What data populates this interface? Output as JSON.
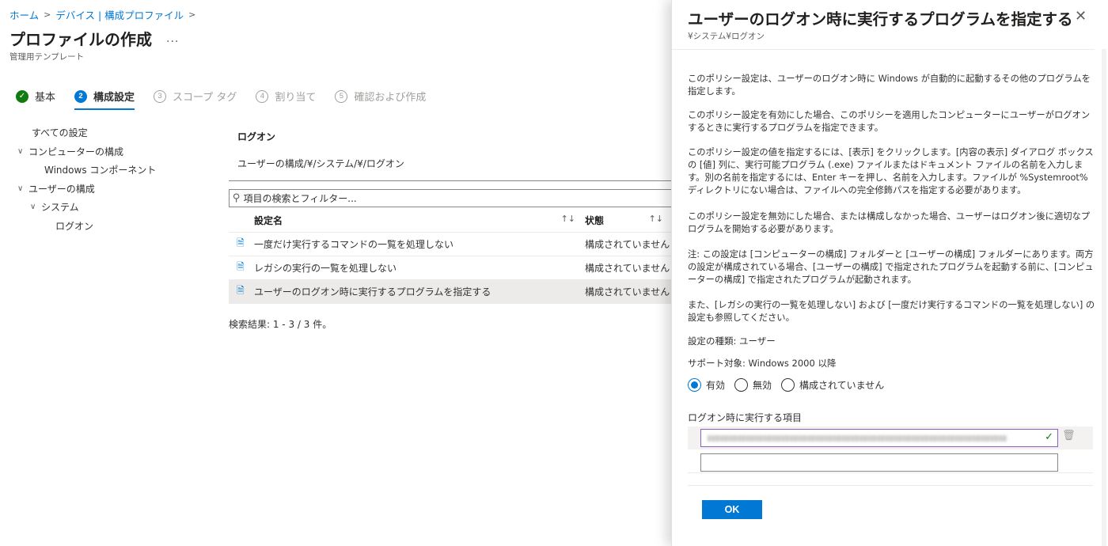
{
  "breadcrumb": {
    "items": [
      "ホーム",
      "デバイス | 構成プロファイル"
    ],
    "sep": ">"
  },
  "page": {
    "title": "プロファイルの作成",
    "more": "...",
    "subtitle": "管理用テンプレート"
  },
  "steps": [
    {
      "num": "✓",
      "label": "基本",
      "status": "done"
    },
    {
      "num": "2",
      "label": "構成設定",
      "status": "active"
    },
    {
      "num": "3",
      "label": "スコープ タグ",
      "status": "disabled"
    },
    {
      "num": "4",
      "label": "割り当て",
      "status": "disabled"
    },
    {
      "num": "5",
      "label": "確認および作成",
      "status": "disabled"
    }
  ],
  "tree": [
    {
      "label": "すべての設定",
      "chev": ""
    },
    {
      "label": "コンピューターの構成",
      "chev": "∨"
    },
    {
      "label": "Windows コンポーネント",
      "chev": ""
    },
    {
      "label": "ユーザーの構成",
      "chev": "∨"
    },
    {
      "label": "システム",
      "chev": "∨"
    },
    {
      "label": "ログオン",
      "chev": ""
    }
  ],
  "content": {
    "section_title": "ログオン",
    "path": "ユーザーの構成/¥/システム/¥/ログオン",
    "search_placeholder": "項目の検索とフィルター...",
    "columns": {
      "name": "設定名",
      "state": "状態",
      "sort": "↑↓"
    },
    "rows": [
      {
        "name": "一度だけ実行するコマンドの一覧を処理しない",
        "state": "構成されていません"
      },
      {
        "name": "レガシの実行の一覧を処理しない",
        "state": "構成されていません"
      },
      {
        "name": "ユーザーのログオン時に実行するプログラムを指定する",
        "state": "構成されていません"
      }
    ],
    "results": "検索結果: 1 - 3 / 3 件。"
  },
  "blade": {
    "title": "ユーザーのログオン時に実行するプログラムを指定する",
    "close": "✕",
    "subtitle": "¥システム¥ログオン",
    "paragraphs": [
      "このポリシー設定は、ユーザーのログオン時に Windows が自動的に起動するその他のプログラムを指定します。",
      "このポリシー設定を有効にした場合、このポリシーを適用したコンピューターにユーザーがログオンするときに実行するプログラムを指定できます。",
      "このポリシー設定の値を指定するには、[表示] をクリックします。[内容の表示] ダイアログ ボックスの [値] 列に、実行可能プログラム (.exe) ファイルまたはドキュメント ファイルの名前を入力します。別の名前を指定するには、Enter キーを押し、名前を入力します。ファイルが %Systemroot% ディレクトリにない場合は、ファイルへの完全修飾パスを指定する必要があります。",
      "このポリシー設定を無効にした場合、または構成しなかった場合、ユーザーはログオン後に適切なプログラムを開始する必要があります。",
      "注: この設定は [コンピューターの構成] フォルダーと [ユーザーの構成] フォルダーにあります。両方の設定が構成されている場合、[ユーザーの構成] で指定されたプログラムを起動する前に、[コンピューターの構成] で指定されたプログラムが起動されます。",
      "また、[レガシの実行の一覧を処理しない] および [一度だけ実行するコマンドの一覧を処理しない] の設定も参照してください。"
    ],
    "setting_type": "設定の種類: ユーザー",
    "supported": "サポート対象: Windows 2000 以降",
    "radios": [
      {
        "label": "有効",
        "checked": true
      },
      {
        "label": "無効",
        "checked": false
      },
      {
        "label": "構成されていません",
        "checked": false
      }
    ],
    "list_label": "ログオン時に実行する項目",
    "check_icon": "✓",
    "trash_icon": "🗑",
    "ok_label": "OK"
  },
  "colors": {
    "accent": "#0078d4",
    "success": "#107c10",
    "selected_row": "#edebe9"
  }
}
